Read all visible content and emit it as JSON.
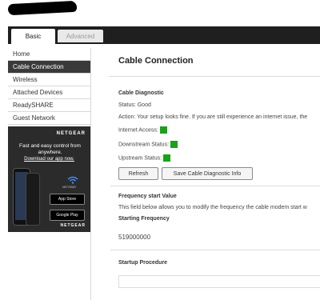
{
  "header": {
    "tabs": [
      {
        "label": "Basic"
      },
      {
        "label": "Advanced"
      }
    ]
  },
  "sidebar": {
    "items": [
      {
        "label": "Home"
      },
      {
        "label": "Cable Connection"
      },
      {
        "label": "Wireless"
      },
      {
        "label": "Attached Devices"
      },
      {
        "label": "ReadySHARE"
      },
      {
        "label": "Guest Network"
      }
    ],
    "ad": {
      "logo": "NETGEAR",
      "text": "Fast and easy control from anywhere.",
      "link": "Download our app now.",
      "phone_label": "NETGEAR",
      "app_store": "App Store",
      "google_play": "Google Play",
      "footer": "NETGEAR"
    }
  },
  "main": {
    "title": "Cable Connection",
    "diagnostic": {
      "heading": "Cable Diagnostic",
      "status": "Status: Good",
      "action": "Action: Your setup looks fine. If you are still experience an internet issue, the",
      "internet_access": "Internet Access:",
      "downstream_status": "Downstream Status:",
      "upstream_status": "Upstream Status:",
      "status_color": "#18a218"
    },
    "buttons": {
      "refresh": "Refresh",
      "save": "Save Cable Diagnostic Info"
    },
    "frequency": {
      "heading": "Frequency start Value",
      "description": "This field below allows you to modify the frequency the cable modem start w",
      "label": "Starting Frequency",
      "value": "519000000"
    },
    "startup": {
      "heading": "Startup Procedure"
    }
  }
}
